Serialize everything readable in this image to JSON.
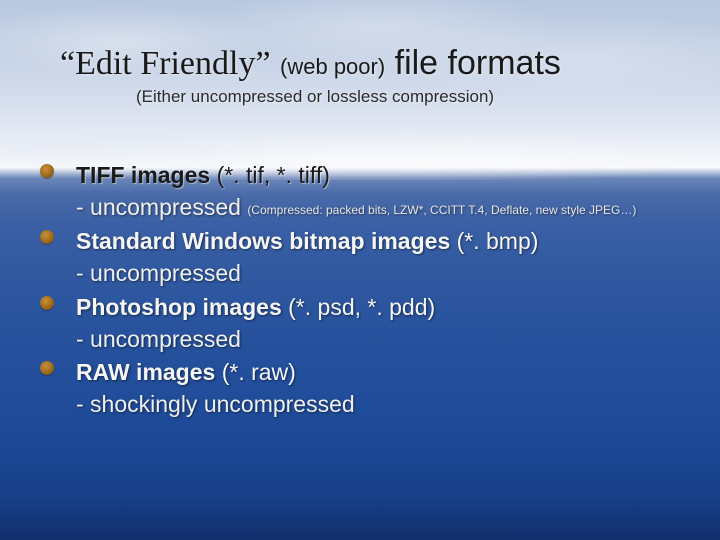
{
  "title": {
    "pre": "“Edit Friendly”",
    "web": "(web poor)",
    "post": "file formats"
  },
  "subtitle": "(Either uncompressed or lossless compression)",
  "items": [
    {
      "name": "TIFF images",
      "ext": "(*. tif, *. tiff)",
      "sub": "- uncompressed",
      "fine": "(Compressed: packed bits, LZW*, CCITT T.4, Deflate, new style JPEG…)"
    },
    {
      "name": "Standard Windows bitmap images",
      "ext": "(*. bmp)",
      "sub": "- uncompressed",
      "fine": ""
    },
    {
      "name": "Photoshop images",
      "ext": "(*. psd, *. pdd)",
      "sub": "- uncompressed",
      "fine": ""
    },
    {
      "name": "RAW images",
      "ext": "(*. raw)",
      "sub": "- shockingly uncompressed",
      "fine": ""
    }
  ]
}
